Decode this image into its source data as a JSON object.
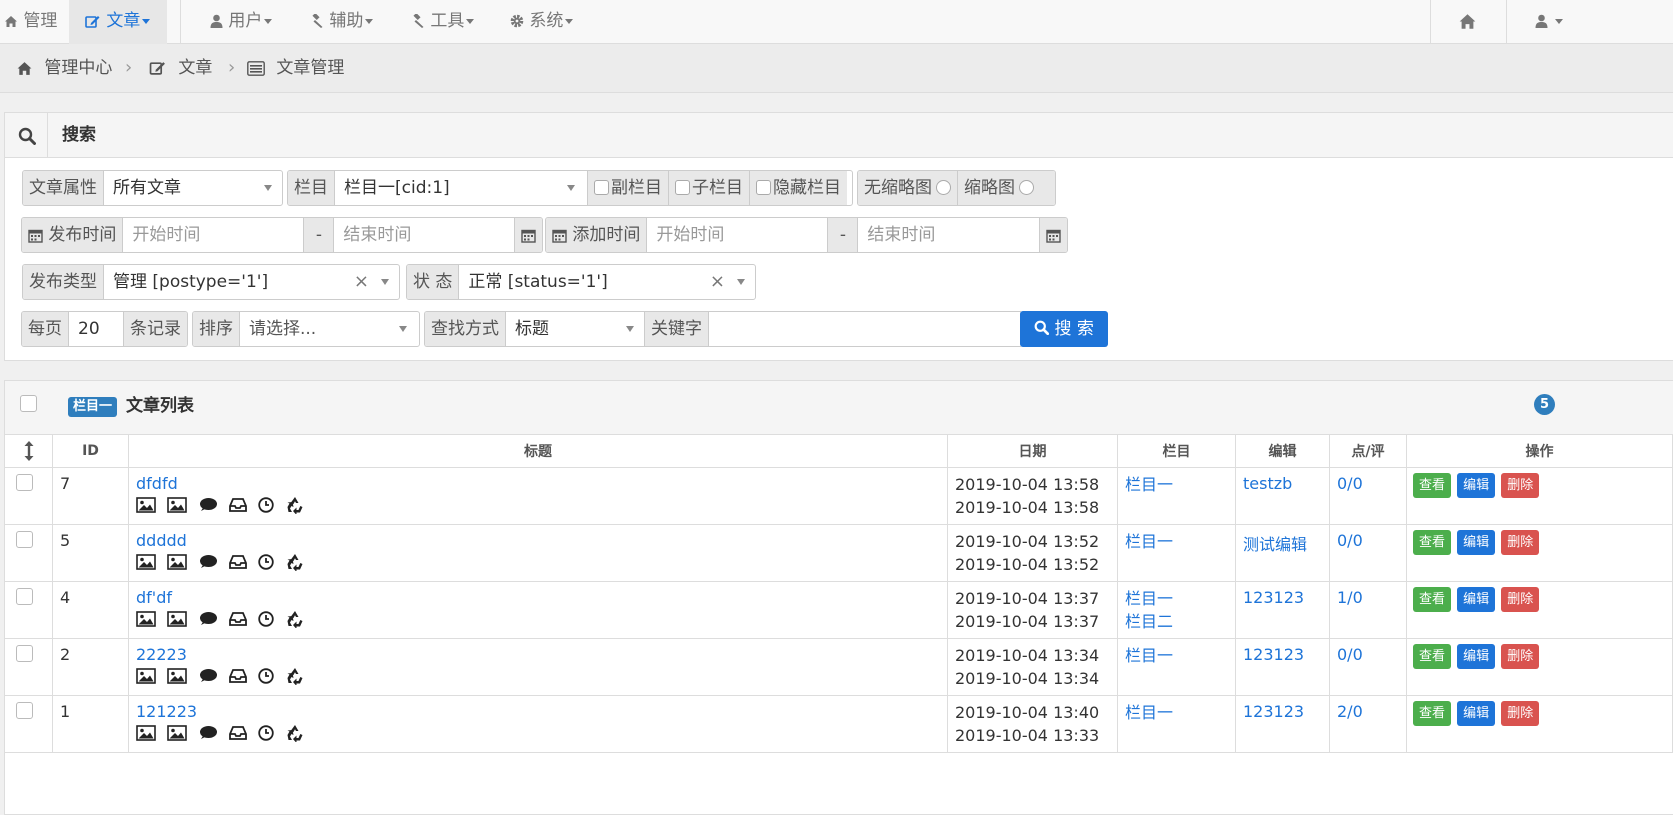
{
  "nav": {
    "items": [
      {
        "label": "管理"
      },
      {
        "label": "文章"
      },
      {
        "label": "用户"
      },
      {
        "label": "辅助"
      },
      {
        "label": "工具"
      },
      {
        "label": "系统"
      }
    ]
  },
  "breadcrumb": [
    "管理中心",
    "文章",
    "文章管理"
  ],
  "search": {
    "title": "搜索",
    "attr_label": "文章属性",
    "attr_value": "所有文章",
    "column_label": "栏目",
    "column_value": "栏目一[cid:1]",
    "sub_column": "副栏目",
    "child_column": "子栏目",
    "hidden_column": "隐藏栏目",
    "no_thumb": "无缩略图",
    "thumb": "缩略图",
    "pub_time_label": "发布时间",
    "add_time_label": "添加时间",
    "start_placeholder": "开始时间",
    "end_placeholder": "结束时间",
    "dash": "-",
    "post_type_label": "发布类型",
    "post_type_value": "管理 [postype='1']",
    "status_label": "状 态",
    "status_value": "正常 [status='1']",
    "clear_symbol": "×",
    "per_page_label": "每页",
    "per_page_value": "20",
    "per_page_suffix": "条记录",
    "sort_label": "排序",
    "sort_placeholder": "请选择...",
    "find_label": "查找方式",
    "find_value": "标题",
    "keyword_label": "关键字",
    "keyword_value": "",
    "button": "搜 索"
  },
  "list": {
    "badge": "栏目一",
    "title": "文章列表",
    "count": "5",
    "headers": {
      "id": "ID",
      "title": "标题",
      "date": "日期",
      "column": "栏目",
      "editor": "编辑",
      "stats": "点/评",
      "ops": "操作"
    },
    "op_labels": {
      "view": "查看",
      "edit": "编辑",
      "delete": "删除"
    },
    "rows": [
      {
        "id": "7",
        "title": "dfdfd",
        "date1": "2019-10-04 13:58",
        "date2": "2019-10-04 13:58",
        "col1": "栏目一",
        "col2": "",
        "editor": "testzb",
        "stats": "0/0"
      },
      {
        "id": "5",
        "title": "ddddd",
        "date1": "2019-10-04 13:52",
        "date2": "2019-10-04 13:52",
        "col1": "栏目一",
        "col2": "",
        "editor": "测试编辑",
        "stats": "0/0"
      },
      {
        "id": "4",
        "title": "df'df",
        "date1": "2019-10-04 13:37",
        "date2": "2019-10-04 13:37",
        "col1": "栏目一",
        "col2": "栏目二",
        "editor": "123123",
        "stats": "1/0"
      },
      {
        "id": "2",
        "title": "22223",
        "date1": "2019-10-04 13:34",
        "date2": "2019-10-04 13:34",
        "col1": "栏目一",
        "col2": "",
        "editor": "123123",
        "stats": "0/0"
      },
      {
        "id": "1",
        "title": "121223",
        "date1": "2019-10-04 13:40",
        "date2": "2019-10-04 13:33",
        "col1": "栏目一",
        "col2": "",
        "editor": "123123",
        "stats": "2/0"
      }
    ]
  },
  "row_icons": [
    "image-icon",
    "image-icon",
    "comment-icon",
    "inbox-icon",
    "clock-icon",
    "recycle-icon"
  ],
  "colors": {
    "primary": "#1e74d8",
    "success": "#4cae4c",
    "danger": "#d9534f",
    "badge": "#2f7ebd"
  }
}
